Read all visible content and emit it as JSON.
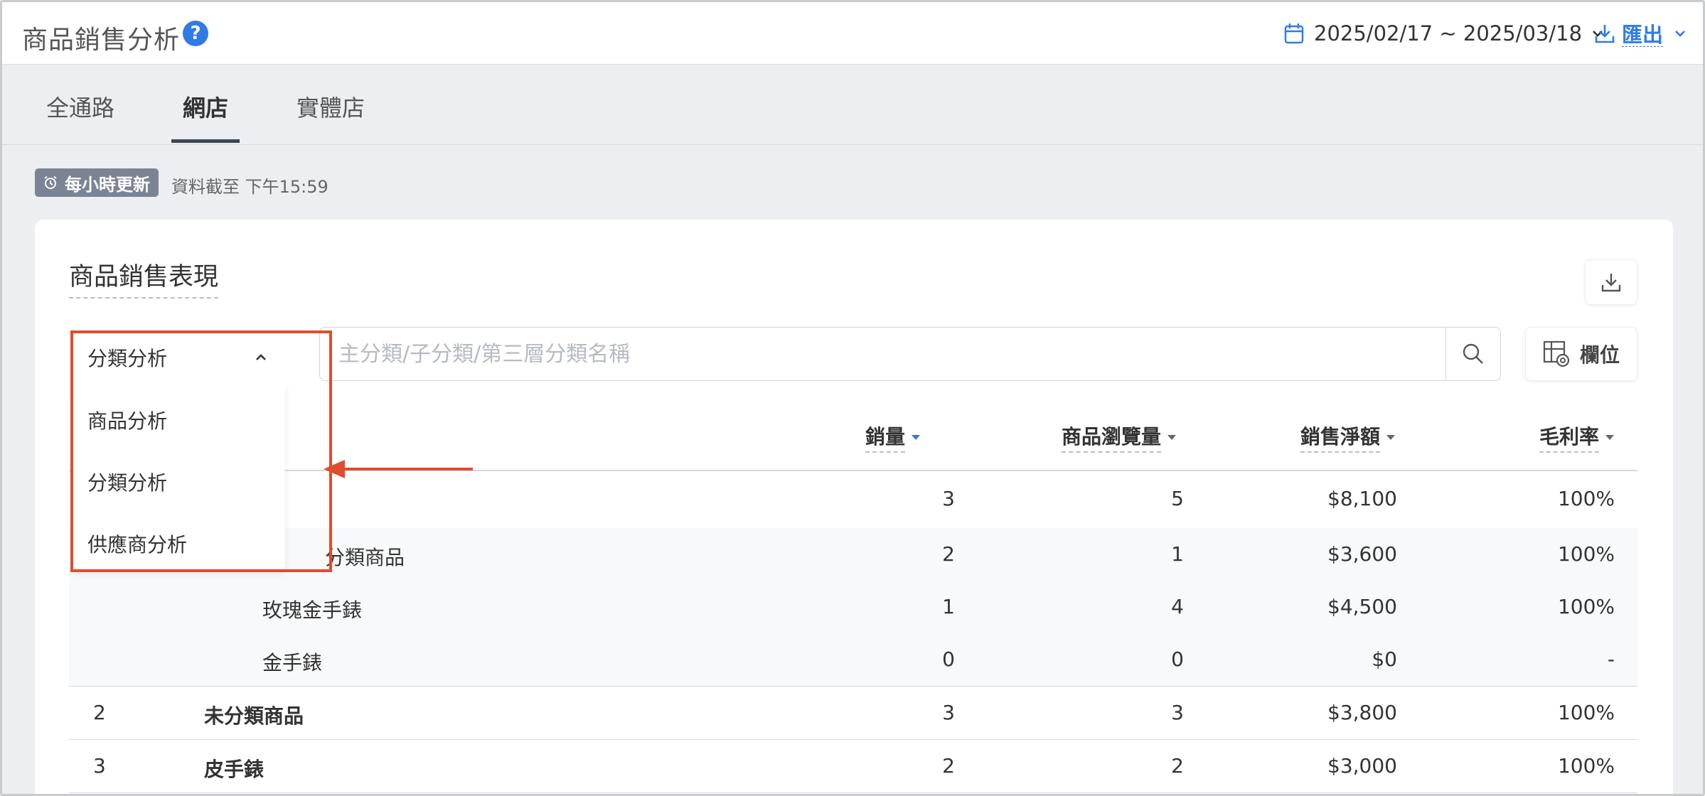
{
  "header": {
    "title": "商品銷售分析",
    "help_glyph": "?",
    "date_range": "2025/02/17 ~ 2025/03/18",
    "export_label": "匯出"
  },
  "tabs": [
    {
      "label": "全通路",
      "active": false
    },
    {
      "label": "網店",
      "active": true
    },
    {
      "label": "實體店",
      "active": false
    }
  ],
  "update": {
    "badge": "每小時更新",
    "note": "資料截至 下午15:59"
  },
  "card": {
    "title": "商品銷售表現"
  },
  "analysis_select": {
    "selected": "分類分析",
    "options": [
      "商品分析",
      "分類分析",
      "供應商分析"
    ]
  },
  "search": {
    "placeholder": "主分類/子分類/第三層分類名稱"
  },
  "columns_button": "欄位",
  "table": {
    "headers": [
      "銷量",
      "商品瀏覽量",
      "銷售淨額",
      "毛利率"
    ],
    "rows": [
      {
        "rank": "",
        "name": "",
        "qty": "3",
        "views": "5",
        "net": "$8,100",
        "margin": "100%"
      },
      {
        "rank": "",
        "name": "分類商品",
        "qty": "2",
        "views": "1",
        "net": "$3,600",
        "margin": "100%"
      },
      {
        "rank": "",
        "name": "玫瑰金手錶",
        "qty": "1",
        "views": "4",
        "net": "$4,500",
        "margin": "100%"
      },
      {
        "rank": "",
        "name": "金手錶",
        "qty": "0",
        "views": "0",
        "net": "$0",
        "margin": "-"
      },
      {
        "rank": "2",
        "name": "未分類商品",
        "qty": "3",
        "views": "3",
        "net": "$3,800",
        "margin": "100%"
      },
      {
        "rank": "3",
        "name": "皮手錶",
        "qty": "2",
        "views": "2",
        "net": "$3,000",
        "margin": "100%"
      }
    ]
  },
  "colors": {
    "accent": "#2f7be6",
    "highlight": "#e24b2f",
    "badge": "#7b8494"
  }
}
